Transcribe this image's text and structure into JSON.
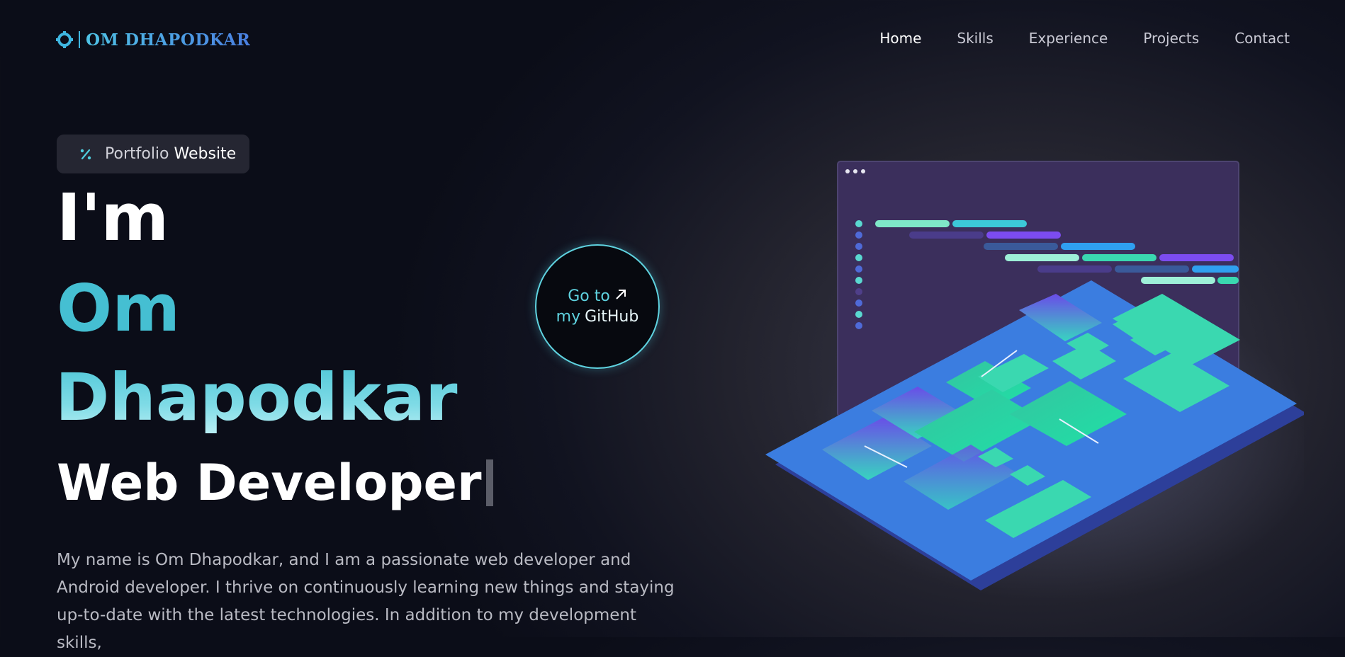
{
  "header": {
    "logo_text": "OM DHAPODKAR",
    "nav": [
      {
        "label": "Home",
        "active": true
      },
      {
        "label": "Skills",
        "active": false
      },
      {
        "label": "Experience",
        "active": false
      },
      {
        "label": "Projects",
        "active": false
      },
      {
        "label": "Contact",
        "active": false
      }
    ]
  },
  "badge": {
    "prefix": "Portfolio",
    "suffix": "Website",
    "icon": "percent-icon"
  },
  "hero": {
    "greeting": "I'm",
    "first_name": "Om",
    "last_name": "Dhapodkar",
    "role": "Web Developer"
  },
  "github_button": {
    "line1": "Go to",
    "line2_prefix": "my",
    "line2_suffix": "GitHub",
    "icon": "arrow-up-right-icon"
  },
  "bio": "My name is Om Dhapodkar, and I am a passionate web developer and Android developer. I thrive on continuously learning new things and staying up-to-date with the latest technologies. In addition to my development skills,",
  "colors": {
    "accent": "#45bfd2",
    "brand_gradient_start": "#4fc3e6",
    "brand_gradient_end": "#4a7fe0",
    "background": "#0b0d18"
  }
}
